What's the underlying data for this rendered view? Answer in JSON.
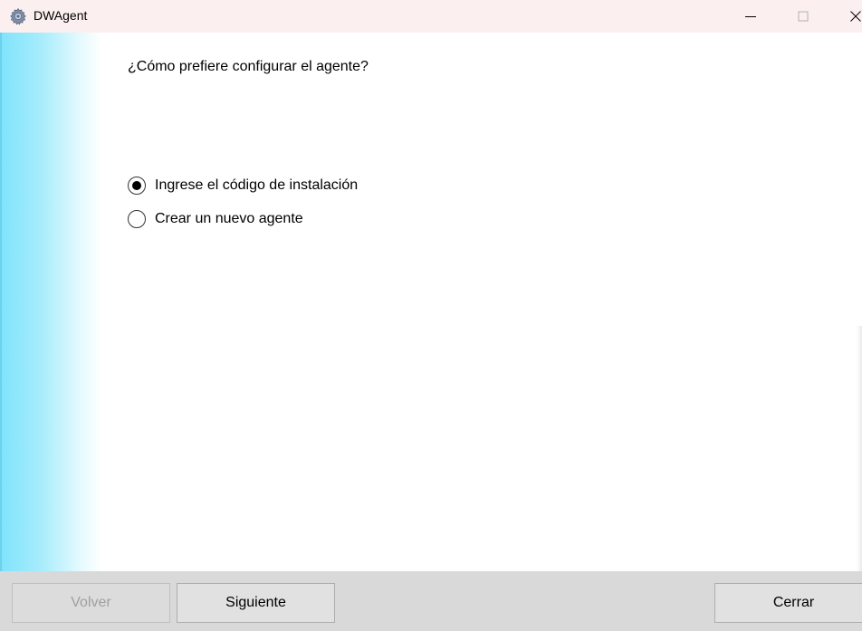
{
  "window": {
    "title": "DWAgent",
    "icon": "gear-icon"
  },
  "main": {
    "question": "¿Cómo prefiere configurar el agente?",
    "options": [
      {
        "label": "Ingrese el código de instalación",
        "selected": true
      },
      {
        "label": "Crear un nuevo agente",
        "selected": false
      }
    ]
  },
  "footer": {
    "back_label": "Volver",
    "next_label": "Siguiente",
    "close_label": "Cerrar"
  },
  "colors": {
    "titlebar": "#fbf0ef",
    "side_gradient_start": "#7fe3fb",
    "footer": "#d9d9d9",
    "disabled_text": "#a0a0a0"
  }
}
